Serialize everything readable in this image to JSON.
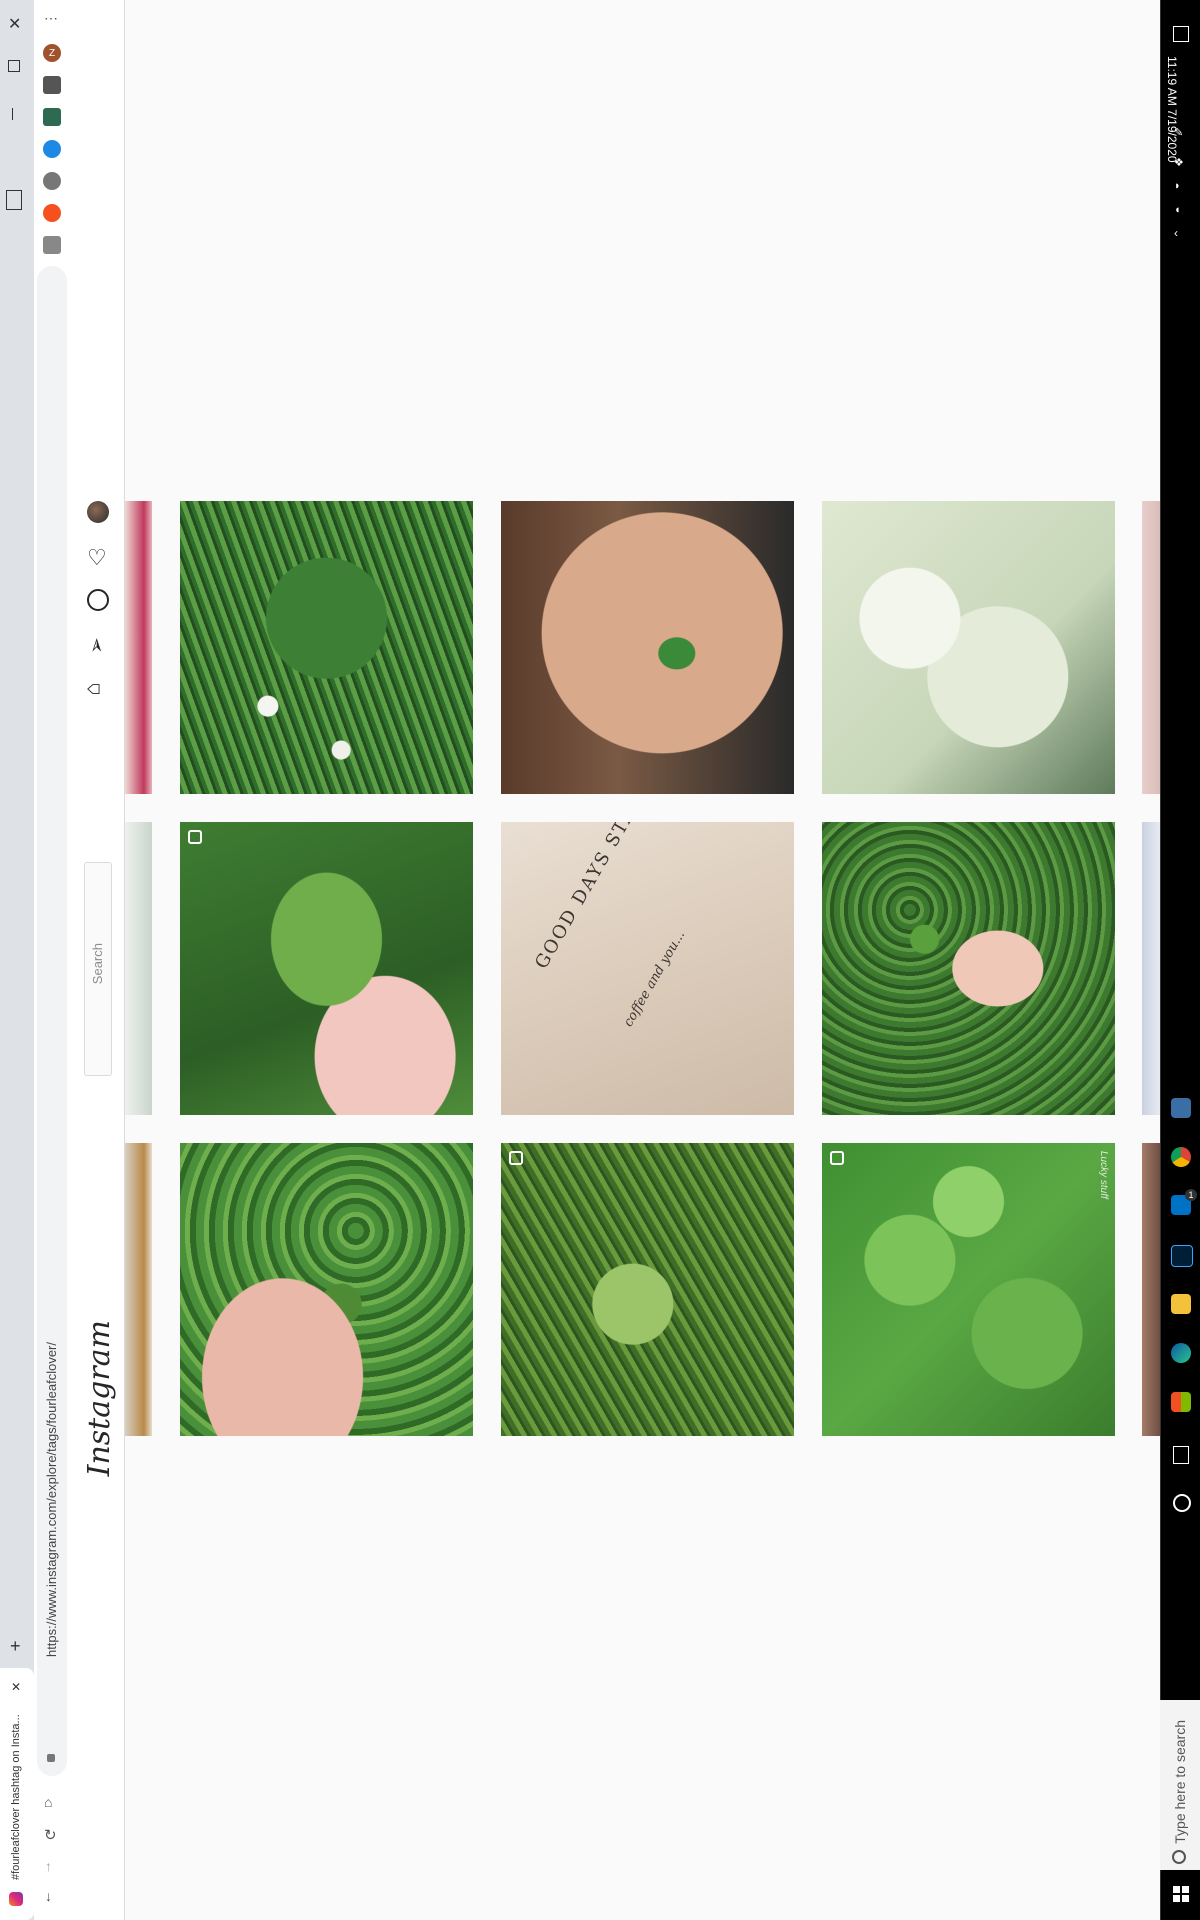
{
  "browser": {
    "tab_title": "#fourleafclover hashtag on Insta...",
    "url": "https://www.instagram.com/explore/tags/fourleafclover/",
    "extension_initial": "Z"
  },
  "instagram": {
    "logo": "Instagram",
    "search_placeholder": "Search"
  },
  "taskbar": {
    "time": "11:19 AM",
    "date": "7/19/2020",
    "search_placeholder": "Type here to search",
    "mail_badge": "1"
  },
  "grid": {
    "rows": [
      [
        {
          "subject": "clover patch with white flowers",
          "badge": ""
        },
        {
          "subject": "cupped hands holding clover",
          "badge": ""
        },
        {
          "subject": "pale white hydrangea",
          "badge": ""
        }
      ],
      [
        {
          "subject": "hand holding four-leaf clover",
          "badge": "video"
        },
        {
          "subject": "GOOD DAYS START WITH coffee and you... shirt",
          "badge": ""
        },
        {
          "subject": "hand with two clovers in ground cover",
          "badge": ""
        }
      ],
      [
        {
          "subject": "hand holding clover over patch",
          "badge": ""
        },
        {
          "subject": "four-leaf clover in grass",
          "badge": "carousel"
        },
        {
          "subject": "lush clover leaves",
          "badge": "carousel"
        }
      ]
    ],
    "shirt_text_line1": "GOOD DAYS START WITH",
    "shirt_text_line2": "coffee and you...",
    "watermark": "Lucky stuff"
  },
  "colors": {
    "accent": "#0095f6",
    "taskbar": "#000000",
    "clover": "#4a8f3a"
  }
}
